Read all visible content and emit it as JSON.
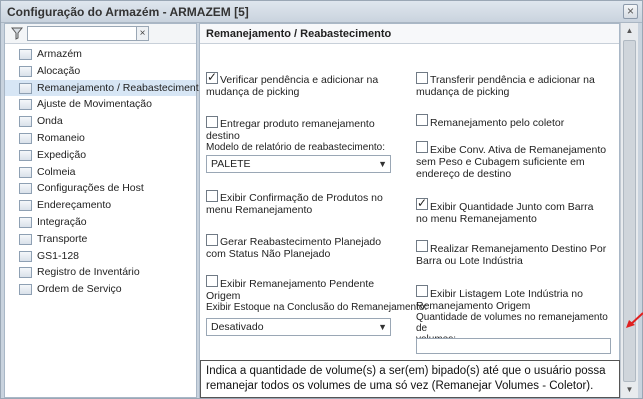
{
  "window": {
    "title": "Configuração do Armazém - ARMAZEM [5]",
    "close": "×"
  },
  "nav": {
    "filter_value": "",
    "clear": "×",
    "items": [
      "Armazém",
      "Alocação",
      "Remanejamento / Reabastecimento",
      "Ajuste de Movimentação",
      "Onda",
      "Romaneio",
      "Expedição",
      "Colmeia",
      "Configurações de Host",
      "Endereçamento",
      "Integração",
      "Transporte",
      "GS1-128",
      "Registro de Inventário",
      "Ordem de Serviço"
    ],
    "selected_index": 2
  },
  "main": {
    "header": "Remanejamento / Reabastecimento",
    "left": [
      {
        "label": "Verificar pendência e adicionar na\nmudança de picking",
        "checked": true
      },
      {
        "label": "Entregar produto remanejamento\ndestino",
        "checked": false,
        "sublabel": "Modelo de relatório de reabastecimento:",
        "select": "PALETE"
      },
      {
        "label": "Exibir Confirmação de Produtos no\nmenu Remanejamento",
        "checked": false
      },
      {
        "label": "Gerar Reabastecimento Planejado\ncom Status Não Planejado",
        "checked": false
      },
      {
        "label": "Exibir Remanejamento Pendente\nOrigem",
        "checked": false,
        "sublabel": "Exibir Estoque na Conclusão do Remanejamento:",
        "select": "Desativado"
      }
    ],
    "right": [
      {
        "label": "Transferir pendência e adicionar na\nmudança de picking",
        "checked": false
      },
      {
        "label": "Remanejamento pelo coletor",
        "checked": false
      },
      {
        "label": "Exibe Conv. Ativa de Remanejamento\nsem Peso e Cubagem suficiente em\nendereço de destino",
        "checked": false
      },
      {
        "label": "Exibir Quantidade Junto com Barra\nno menu Remanejamento",
        "checked": true
      },
      {
        "label": "Realizar Remanejamento Destino Por\nBarra ou Lote Indústria",
        "checked": false
      },
      {
        "label": "Exibir Listagem Lote Indústria no\nRemanejamento Origem",
        "checked": false,
        "sublabel": "Quantidade de volumes no remanejamento de\nvolumes:",
        "input": ""
      }
    ]
  },
  "tooltip": "Indica a quantidade de volume(s) a ser(em) bipado(s) até que o usuário possa remanejar todos os volumes de uma só vez (Remanejar Volumes - Coletor).",
  "colors": {
    "accent_arrow": "#e02020",
    "selected_bg": "#d7e6f5"
  }
}
